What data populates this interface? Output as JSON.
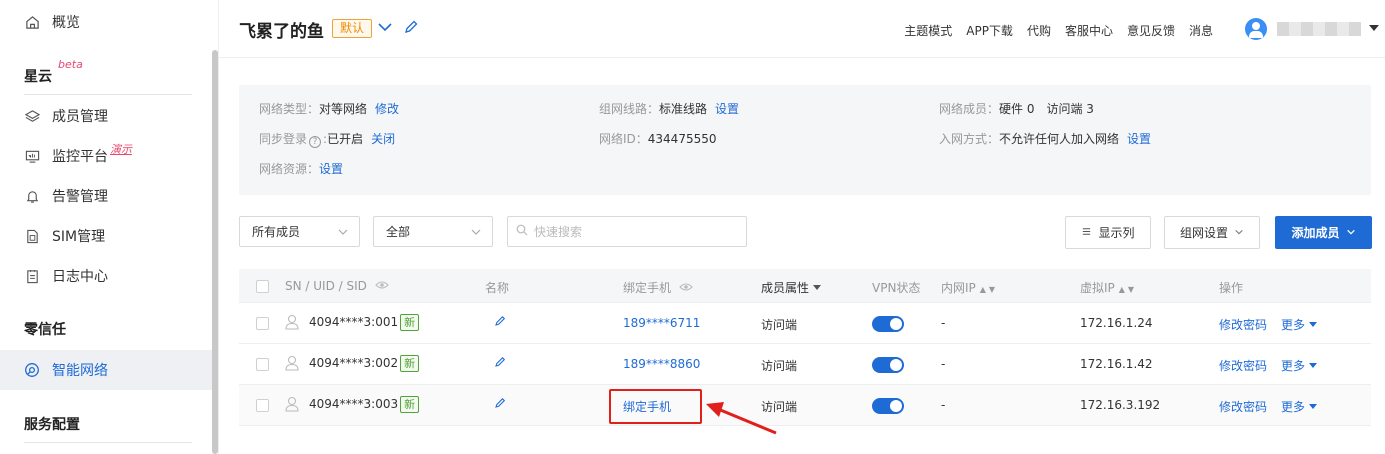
{
  "sidebar": {
    "items": [
      {
        "label": "概览",
        "icon": "home-icon"
      },
      {
        "label": "成员管理",
        "icon": "layers-icon"
      },
      {
        "label": "监控平台",
        "icon": "monitor-icon",
        "tag": "演示"
      },
      {
        "label": "告警管理",
        "icon": "bell-icon"
      },
      {
        "label": "SIM管理",
        "icon": "sim-card-icon"
      },
      {
        "label": "日志中心",
        "icon": "log-icon"
      },
      {
        "label": "智能网络",
        "icon": "network-icon"
      }
    ],
    "sections": {
      "xingyun": "星云",
      "xingyun_tag": "beta",
      "zero_trust": "零信任",
      "service_config": "服务配置"
    }
  },
  "header": {
    "network_name": "飞累了的鱼",
    "default_badge": "默认",
    "nav": [
      "主题模式",
      "APP下载",
      "代购",
      "客服中心",
      "意见反馈",
      "消息"
    ]
  },
  "info": {
    "network_type_label": "网络类型：",
    "network_type_value": "对等网络",
    "network_type_action": "修改",
    "route_label": "组网线路：",
    "route_value": "标准线路",
    "route_action": "设置",
    "members_label": "网络成员：",
    "members_value": "硬件 0　访问端 3",
    "sync_label": "同步登录",
    "sync_value": "已开启",
    "sync_action": "关闭",
    "net_id_label": "网络ID：",
    "net_id_value": "434475550",
    "join_label": "入网方式：",
    "join_value": "不允许任何人加入网络",
    "join_action": "设置",
    "resource_label": "网络资源：",
    "resource_action": "设置"
  },
  "toolbar": {
    "member_filter": "所有成员",
    "status_filter": "全部",
    "search_placeholder": "快速搜索",
    "columns_button": "显示列",
    "group_settings_button": "组网设置",
    "add_member_button": "添加成员"
  },
  "table": {
    "headers": {
      "sn": "SN / UID / SID",
      "name": "名称",
      "phone": "绑定手机",
      "attr": "成员属性",
      "vpn": "VPN状态",
      "lan_ip": "内网IP",
      "virtual_ip": "虚拟IP",
      "ops": "操作"
    },
    "new_tag": "新",
    "change_password": "修改密码",
    "more": "更多",
    "rows": [
      {
        "sn": "4094****3:001",
        "phone": "189****6711",
        "attr": "访问端",
        "vpn": true,
        "lan_ip": "-",
        "virtual_ip": "172.16.1.24"
      },
      {
        "sn": "4094****3:002",
        "phone": "189****8860",
        "attr": "访问端",
        "vpn": true,
        "lan_ip": "-",
        "virtual_ip": "172.16.1.42"
      },
      {
        "sn": "4094****3:003",
        "phone": "绑定手机",
        "attr": "访问端",
        "vpn": true,
        "lan_ip": "-",
        "virtual_ip": "172.16.3.192"
      }
    ]
  },
  "colors": {
    "accent": "#1f6bd6",
    "badge": "#f08a00",
    "new_tag": "#52a33a",
    "highlight": "#e0201b"
  }
}
